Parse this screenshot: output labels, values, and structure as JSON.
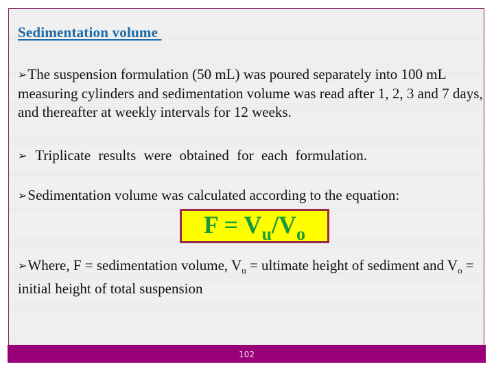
{
  "slide": {
    "title": "Sedimentation volume ",
    "bullet_glyph": "➢",
    "paragraphs": {
      "p1": "The suspension formulation (50 mL) was poured separately into 100 mL measuring cylinders and sedimentation volume was read after 1, 2, 3 and 7 days, and thereafter at weekly intervals for 12 weeks.",
      "p2": " Triplicate results were obtained for each formulation.",
      "p3": "Sedimentation volume was calculated according to the equation:"
    },
    "equation": {
      "lhs": "F = V",
      "sub1": "u",
      "mid": "/V",
      "sub2": "o"
    },
    "where": {
      "part1": "Where, F = sedimentation volume, V",
      "sub_u": "u",
      "part2": " = ultimate height of sediment and V",
      "sub_o": "o",
      "part3": " = initial height of total suspension"
    },
    "page_number": "102"
  },
  "colors": {
    "title": "#1c6aa8",
    "frame_border": "#7a1f5c",
    "footer": "#990077",
    "equation_bg": "#ffff00",
    "equation_border": "#9b2a4a",
    "equation_text": "#1a9a3a"
  }
}
